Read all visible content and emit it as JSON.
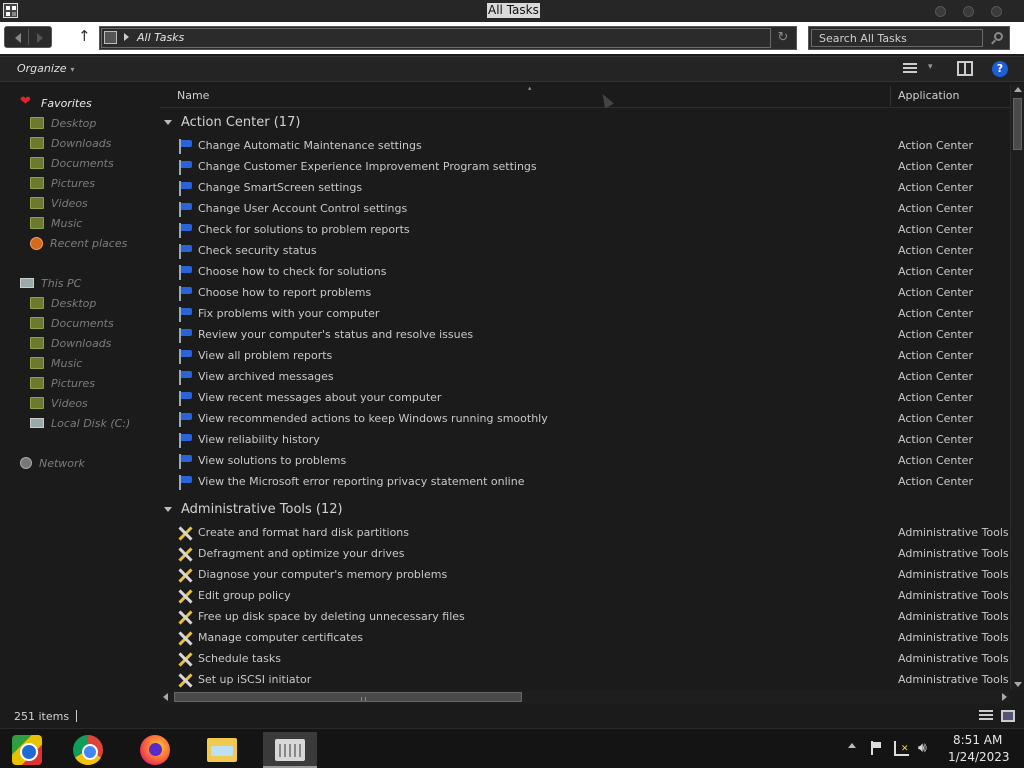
{
  "window": {
    "title": "All Tasks"
  },
  "address": {
    "crumb": "All Tasks"
  },
  "search": {
    "placeholder": "Search All Tasks"
  },
  "toolbar": {
    "organize": "Organize"
  },
  "sidebar": {
    "favorites_head": "Favorites",
    "favorites": [
      "Desktop",
      "Downloads",
      "Documents",
      "Pictures",
      "Videos",
      "Music",
      "Recent places"
    ],
    "pc_head": "This PC",
    "pc": [
      "Desktop",
      "Documents",
      "Downloads",
      "Music",
      "Pictures",
      "Videos",
      "Local Disk (C:)"
    ],
    "network": "Network"
  },
  "columns": {
    "name": "Name",
    "application": "Application"
  },
  "groups": [
    {
      "title": "Action Center (17)",
      "icon": "flag-icon",
      "rows": [
        [
          "Change Automatic Maintenance settings",
          "Action Center"
        ],
        [
          "Change Customer Experience Improvement Program settings",
          "Action Center"
        ],
        [
          "Change SmartScreen settings",
          "Action Center"
        ],
        [
          "Change User Account Control settings",
          "Action Center"
        ],
        [
          "Check for solutions to problem reports",
          "Action Center"
        ],
        [
          "Check security status",
          "Action Center"
        ],
        [
          "Choose how to check for solutions",
          "Action Center"
        ],
        [
          "Choose how to report problems",
          "Action Center"
        ],
        [
          "Fix problems with your computer",
          "Action Center"
        ],
        [
          "Review your computer's status and resolve issues",
          "Action Center"
        ],
        [
          "View all problem reports",
          "Action Center"
        ],
        [
          "View archived messages",
          "Action Center"
        ],
        [
          "View recent messages about your computer",
          "Action Center"
        ],
        [
          "View recommended actions to keep Windows running smoothly",
          "Action Center"
        ],
        [
          "View reliability history",
          "Action Center"
        ],
        [
          "View solutions to problems",
          "Action Center"
        ],
        [
          "View the Microsoft error reporting privacy statement online",
          "Action Center"
        ]
      ]
    },
    {
      "title": "Administrative Tools (12)",
      "icon": "tools-icon",
      "rows": [
        [
          "Create and format hard disk partitions",
          "Administrative Tools"
        ],
        [
          "Defragment and optimize your drives",
          "Administrative Tools"
        ],
        [
          "Diagnose your computer's memory problems",
          "Administrative Tools"
        ],
        [
          "Edit group policy",
          "Administrative Tools"
        ],
        [
          "Free up disk space by deleting unnecessary files",
          "Administrative Tools"
        ],
        [
          "Manage computer certificates",
          "Administrative Tools"
        ],
        [
          "Schedule tasks",
          "Administrative Tools"
        ],
        [
          "Set up iSCSI initiator",
          "Administrative Tools"
        ]
      ]
    }
  ],
  "status": {
    "item_count": "251 items"
  },
  "taskbar": {
    "apps": [
      "box-app-icon",
      "chrome-icon",
      "firefox-icon",
      "file-explorer-icon",
      "control-panel-icon"
    ],
    "time": "8:51 AM",
    "date": "1/24/2023"
  },
  "colors": {
    "flag": "#2a63d9",
    "favorites_heart": "#e0242e",
    "help": "#1e5fd8"
  }
}
